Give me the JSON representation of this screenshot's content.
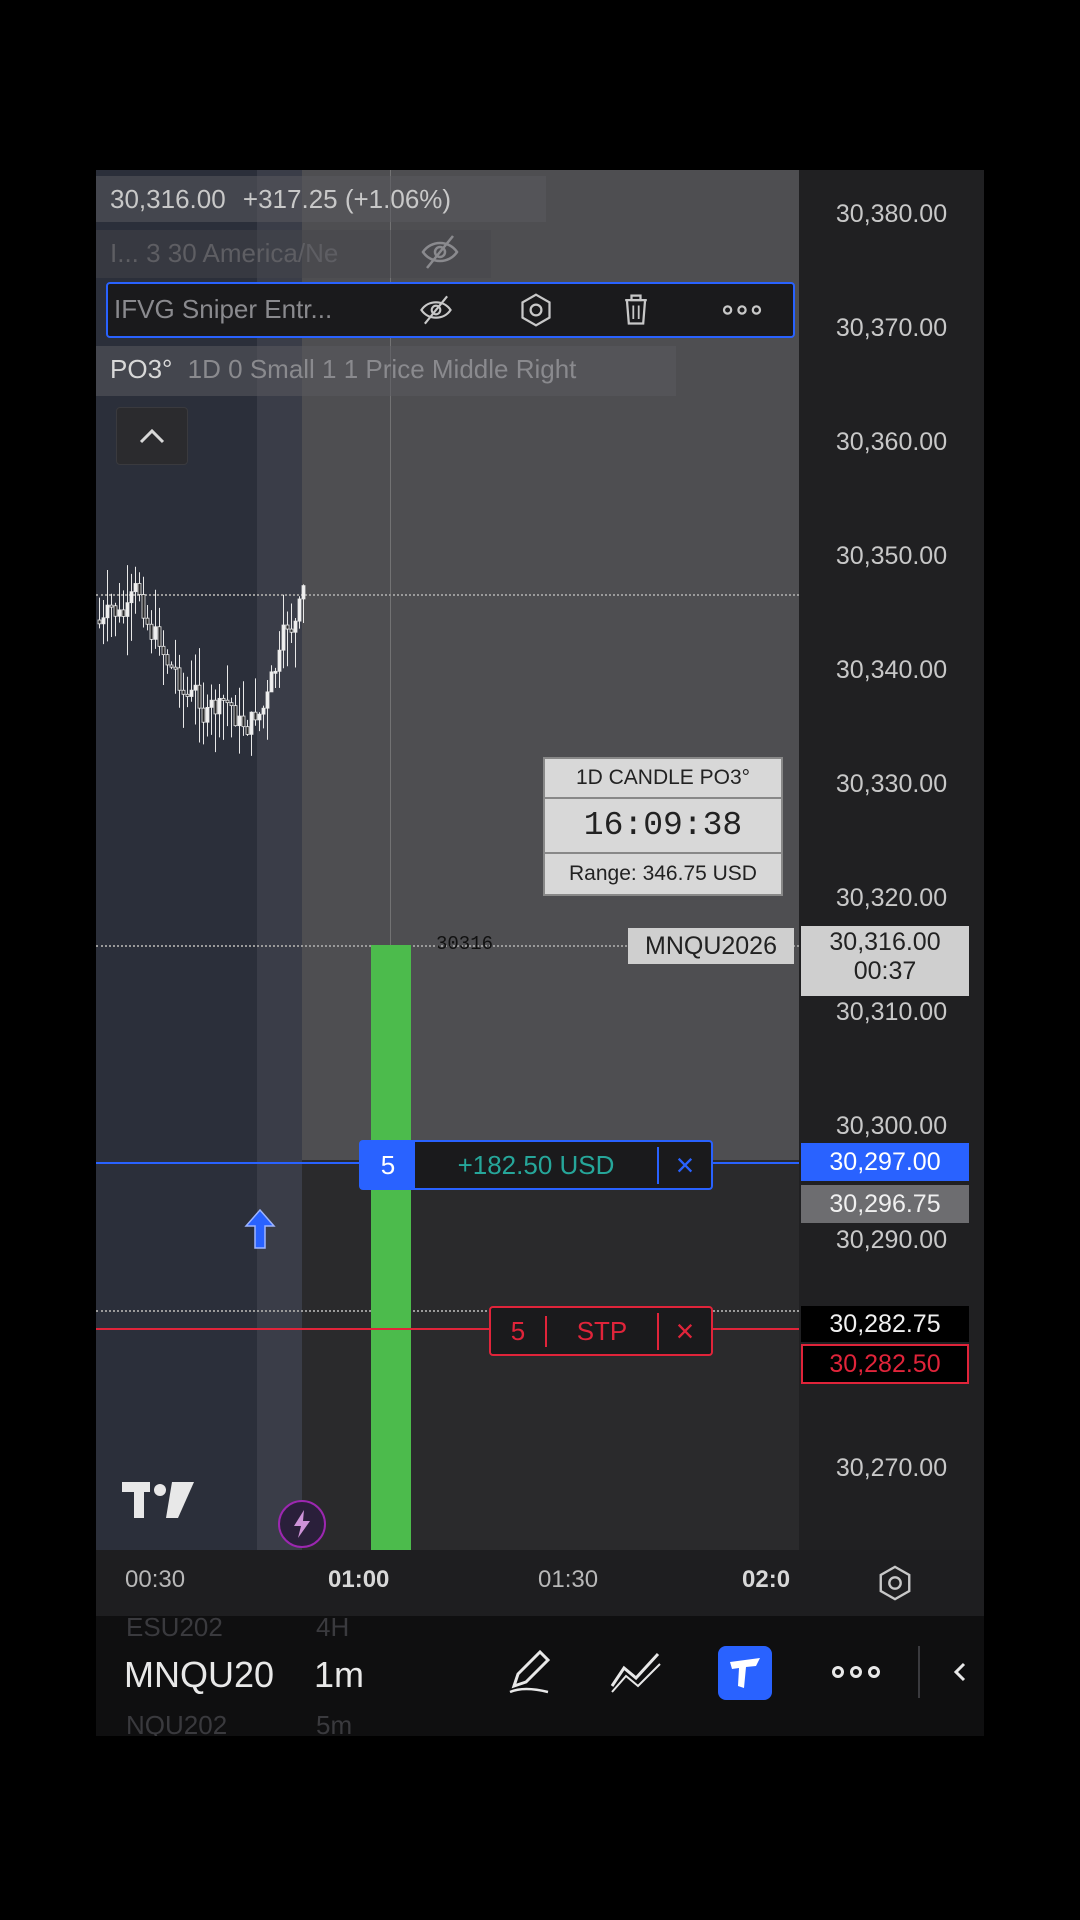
{
  "header": {
    "price": "30,316.00",
    "change": "+317.25 (+1.06%)",
    "faded_indicator": "I... 3 30 America/Ne",
    "active_indicator": "IFVG Sniper Entr...",
    "po3_label": "PO3°",
    "po3_settings": "1D 0 Small 1 1 Price Middle Right"
  },
  "price_scale": {
    "ticks": [
      "30,380.00",
      "30,370.00",
      "30,360.00",
      "30,350.00",
      "30,340.00",
      "30,330.00",
      "30,320.00",
      "30,310.00",
      "30,300.00",
      "30,290.00",
      "30,270.00"
    ],
    "last_price": "30,316.00",
    "countdown": "00:37",
    "symbol_tag": "MNQU2026",
    "entry_price": "30,297.00",
    "bid_price": "30,296.75",
    "dark_price": "30,282.75",
    "stop_price": "30,282.50"
  },
  "chart": {
    "candle_label": "30316",
    "timer_title": "1D CANDLE PO3°",
    "timer_value": "16:09:38",
    "timer_range": "Range: 346.75 USD"
  },
  "orders": {
    "position_qty": "5",
    "position_pnl": "+182.50 USD",
    "stop_qty": "5",
    "stop_label": "STP",
    "close_glyph": "×"
  },
  "time_axis": {
    "labels": [
      "00:30",
      "01:00",
      "01:30",
      "02:0"
    ]
  },
  "toolbar": {
    "symbol": "MNQU20",
    "interval": "1m",
    "ghost_symbol_above": "ESU202",
    "ghost_interval_above": "4H",
    "ghost_symbol_below": "NQU202",
    "ghost_interval_below": "5m"
  },
  "colors": {
    "accent_blue": "#2962ff",
    "stop_red": "#e0243a",
    "candle_green": "#4cbb4c",
    "po3_green": "#26a69a"
  },
  "icons": [
    "eye-off-icon",
    "settings-icon",
    "trash-icon",
    "more-icon",
    "chevron-up-icon",
    "tradingview-logo",
    "lightning-icon",
    "up-arrow-icon",
    "pencil-icon",
    "trendline-icon",
    "indicator-icon",
    "settings-gear-icon",
    "chevron-left-icon"
  ]
}
